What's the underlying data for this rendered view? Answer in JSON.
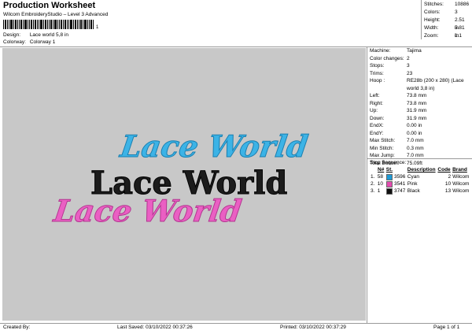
{
  "header": {
    "title": "Production Worksheet",
    "subtitle": "Wilcom EmbroideryStudio – Level 3 Advanced",
    "barcode_number": "1"
  },
  "meta": [
    {
      "key": "Design:",
      "value": "Lace world 5,8 in"
    },
    {
      "key": "Colorway:",
      "value": "Colorway 1"
    }
  ],
  "stats": [
    {
      "key": "Stitches:",
      "value": "10886"
    },
    {
      "key": "Colors:",
      "value": "3"
    },
    {
      "key": "Height:",
      "value": "2.51 in"
    },
    {
      "key": "Width:",
      "value": "5.81 in"
    },
    {
      "key": "Zoom:",
      "value": "1:1"
    }
  ],
  "design_text": {
    "top": "Lace World",
    "middle": "Lace World",
    "bottom": "Lace World"
  },
  "properties": [
    {
      "key": "Machine:",
      "value": "Tajima"
    },
    {
      "key": "Color changes:",
      "value": "2"
    },
    {
      "key": "Stops:",
      "value": "3"
    },
    {
      "key": "Trims:",
      "value": "23"
    },
    {
      "key": "Hoop :",
      "value": "RE28b (200 x 280) (Lace world 3,8 in)"
    },
    {
      "key": "Left:",
      "value": "73.8 mm"
    },
    {
      "key": "Right:",
      "value": "73.8 mm"
    },
    {
      "key": "Up:",
      "value": "31.9 mm"
    },
    {
      "key": "Down:",
      "value": "31.9 mm"
    },
    {
      "key": "EndX:",
      "value": "0.00 in"
    },
    {
      "key": "EndY:",
      "value": "0.00 in"
    },
    {
      "key": "Max Stitch:",
      "value": "7.0 mm"
    },
    {
      "key": "Min Stitch:",
      "value": "0.3 mm"
    },
    {
      "key": "Max Jump:",
      "value": "7.0 mm"
    },
    {
      "key": "Total Bobbin:",
      "value": "75.09ft"
    }
  ],
  "stop_sequence": {
    "title": "Stop Sequence:",
    "headers": [
      "N#",
      "St.",
      "Description",
      "Code",
      "Brand"
    ],
    "rows": [
      {
        "n": "1.",
        "num": "58",
        "code_no": "3596",
        "color": "#1d9ad6",
        "desc": "Cyan",
        "code": "2",
        "brand": "Wilcom"
      },
      {
        "n": "2.",
        "num": "10",
        "code_no": "3541",
        "color": "#e44bb0",
        "desc": "Pink",
        "code": "10",
        "brand": "Wilcom"
      },
      {
        "n": "3.",
        "num": "1",
        "code_no": "3747",
        "color": "#111111",
        "desc": "Black",
        "code": "13",
        "brand": "Wilcom"
      }
    ]
  },
  "footer": {
    "created_by": "Created By:",
    "last_saved": "Last Saved: 03/10/2022 00:37:26",
    "printed": "Printed: 03/10/2022 00:37:29",
    "page": "Page 1 of 1"
  }
}
